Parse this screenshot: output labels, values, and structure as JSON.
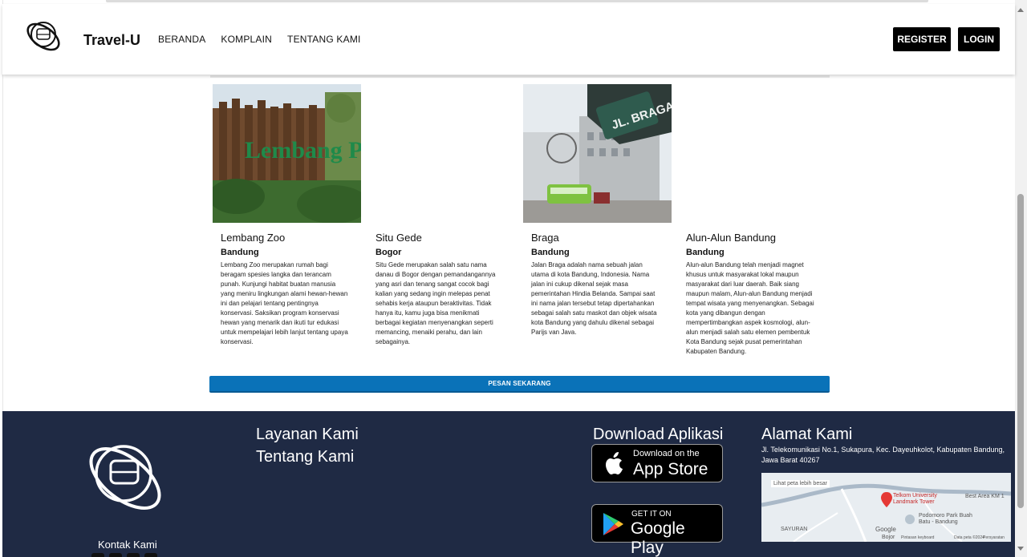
{
  "header": {
    "brand": "Travel-U",
    "nav": [
      "BERANDA",
      "KOMPLAIN",
      "TENTANG KAMI"
    ],
    "register_label": "REGISTER",
    "login_label": "LOGIN"
  },
  "destinations": [
    {
      "name": "Lembang Zoo",
      "city": "Bandung",
      "description": "Lembang Zoo merupakan rumah bagi beragam spesies langka dan terancam punah. Kunjungi habitat buatan manusia yang meniru lingkungan alami hewan-hewan ini dan pelajari tentang pentingnya konservasi. Saksikan program konservasi hewan yang menarik dan ikuti tur edukasi untuk mempelajari lebih lanjut tentang upaya konservasi.",
      "image_text": "Lembang PARK & ZOO"
    },
    {
      "name": "Situ Gede",
      "city": "Bogor",
      "description": "Situ Gede merupakan salah satu nama danau di Bogor dengan pemandangannya yang asri dan tenang sangat cocok bagi kalian yang sedang ingin melepas penat sehabis kerja ataupun beraktivitas. Tidak hanya itu, kamu juga bisa menikmati berbagai kegiatan menyenangkan seperti memancing, menaiki perahu, dan lain sebagainya."
    },
    {
      "name": "Braga",
      "city": "Bandung",
      "description": "Jalan Braga adalah nama sebuah jalan utama di kota Bandung, Indonesia. Nama jalan ini cukup dikenal sejak masa pemerintahan Hindia Belanda. Sampai saat ini nama jalan tersebut tetap dipertahankan sebagai salah satu maskot dan objek wisata kota Bandung yang dahulu dikenal sebagai Parijs van Java.",
      "image_text": "JL. BRAGA"
    },
    {
      "name": "Alun-Alun Bandung",
      "city": "Bandung",
      "description": "Alun-alun Bandung telah menjadi magnet khusus untuk masyarakat lokal maupun masyarakat dari luar daerah. Baik siang maupun malam, Alun-alun Bandung menjadi tempat wisata yang menyenangkan. Sebagai kota yang dibangun dengan mempertimbangkan aspek kosmologi, alun-alun menjadi salah satu elemen pembentuk Kota Bandung sejak pusat pemerintahan Kabupaten Bandung."
    }
  ],
  "cta": {
    "label": "PESAN SEKARANG"
  },
  "footer": {
    "kontak": "Kontak Kami",
    "services": [
      "Layanan Kami",
      "Tentang Kami"
    ],
    "download_heading": "Download Aplikasi",
    "app_store": {
      "small": "Download on the",
      "big": "App Store"
    },
    "google_play": {
      "small": "GET IT ON",
      "big": "Google Play"
    },
    "address_heading": "Alamat Kami",
    "address": "Jl. Telekomunikasi No.1, Sukapura, Kec. Dayeuhkolot, Kabupaten Bandung, Jawa Barat 40267",
    "map": {
      "link": "Lihat peta lebih besar",
      "pin_label": "Telkom University Landmark Tower",
      "labels": [
        "Best Area KM 1",
        "Podomoro Park Buah Batu - Bandung",
        "SAYURAN",
        "Google",
        "Pintasan keyboard",
        "Data peta ©2024",
        "Persyaratan",
        "Bojor"
      ]
    }
  },
  "colors": {
    "cta": "#0a72b8",
    "footer_bg": "#1f2a44",
    "dark_button": "#000000"
  }
}
